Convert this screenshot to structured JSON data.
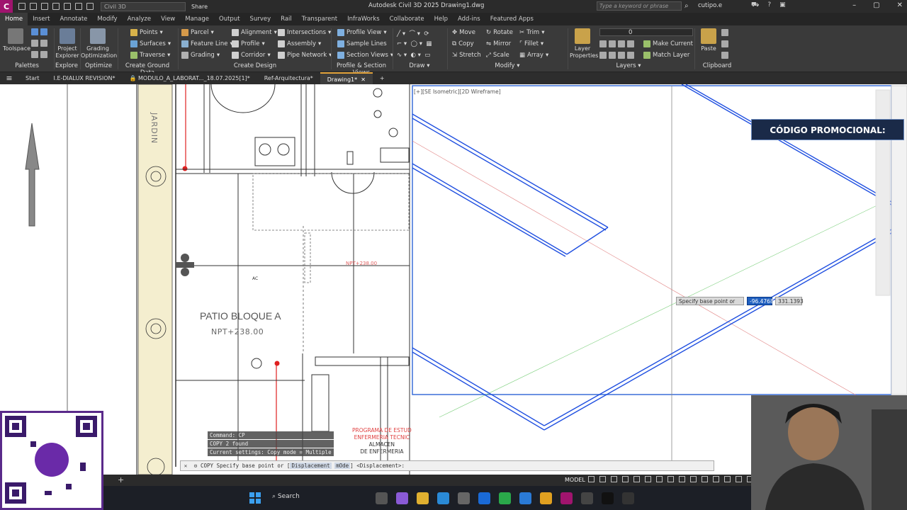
{
  "titlebar": {
    "app_letter": "C",
    "workspace": "Civil 3D",
    "share": "Share",
    "title": "Autodesk Civil 3D 2025   Drawing1.dwg",
    "search_placeholder": "Type a keyword or phrase",
    "user": "cutipo.e"
  },
  "ribbon_tabs": [
    "Home",
    "Insert",
    "Annotate",
    "Modify",
    "Analyze",
    "View",
    "Manage",
    "Output",
    "Survey",
    "Rail",
    "Transparent",
    "InfraWorks",
    "Collaborate",
    "Help",
    "Add-ins",
    "Featured Apps"
  ],
  "ribbon": {
    "toolspace": "Toolspace",
    "palettes": "Palettes",
    "project_explorer": "Project\nExplorer",
    "grading_opt": "Grading\nOptimization",
    "explore": "Explore",
    "optimize": "Optimize",
    "ground": [
      "Points",
      "Surfaces",
      "Traverse"
    ],
    "ground_title": "Create Ground Data",
    "design_col1": [
      "Parcel",
      "Feature Line",
      "Grading"
    ],
    "design_col2": [
      "Alignment",
      "Profile",
      "Corridor"
    ],
    "design_col3": [
      "Intersections",
      "Assembly",
      "Pipe Network"
    ],
    "design_title": "Create Design",
    "profile_views": [
      "Profile View",
      "Sample Lines",
      "Section Views"
    ],
    "profile_title": "Profile & Section Views",
    "draw_title": "Draw",
    "modify_col1": [
      "Move",
      "Copy",
      "Stretch"
    ],
    "modify_col2": [
      "Rotate",
      "Mirror",
      "Scale"
    ],
    "modify_col3": [
      "Trim",
      "Fillet",
      "Array"
    ],
    "modify_title": "Modify",
    "layer_props": "Layer\nProperties",
    "layer_value": "0",
    "layer_items": [
      "Make Current",
      "Match Layer"
    ],
    "layers_title": "Layers",
    "paste": "Paste",
    "clipboard_title": "Clipboard"
  },
  "doc_tabs": [
    "Start",
    "I.E-DIALUX REVISION*",
    "MODULO_A_LABORAT..._18.07.2025[1]*",
    "Ref-Arquitectura*",
    "Drawing1*"
  ],
  "plan": {
    "jardin": "JARDIN",
    "patio": "PATIO BLOQUE A",
    "npt": "NPT+238.00",
    "npt_red": "NPT+238.00",
    "ac": "AC",
    "programa": [
      "PROGRAMA DE ESTUD",
      "ENFERMERIA TECNIC",
      "ALMACEN",
      "DE ENFERMERIA"
    ]
  },
  "viewport2_label": "[+][SE Isometric][2D Wireframe]",
  "promo_text": "CÓDIGO PROMOCIONAL:",
  "tooltip": {
    "label": "Specify base point or",
    "value1": "-96.4768",
    "value2": "331.1393"
  },
  "command_history": [
    "Command: CP",
    "COPY 2 found",
    "Current settings:  Copy mode = Multiple"
  ],
  "command_line": {
    "prefix": "COPY Specify base point or",
    "kw1": "Displacement",
    "kw2": "mOde",
    "suffix": "] <Displacement>:"
  },
  "status": {
    "model": "MODEL"
  },
  "taskbar": {
    "search": "Search"
  },
  "colors": {
    "accent": "#a0146e",
    "blue_lines": "#1f4fe0",
    "red_lines": "#e02020"
  }
}
